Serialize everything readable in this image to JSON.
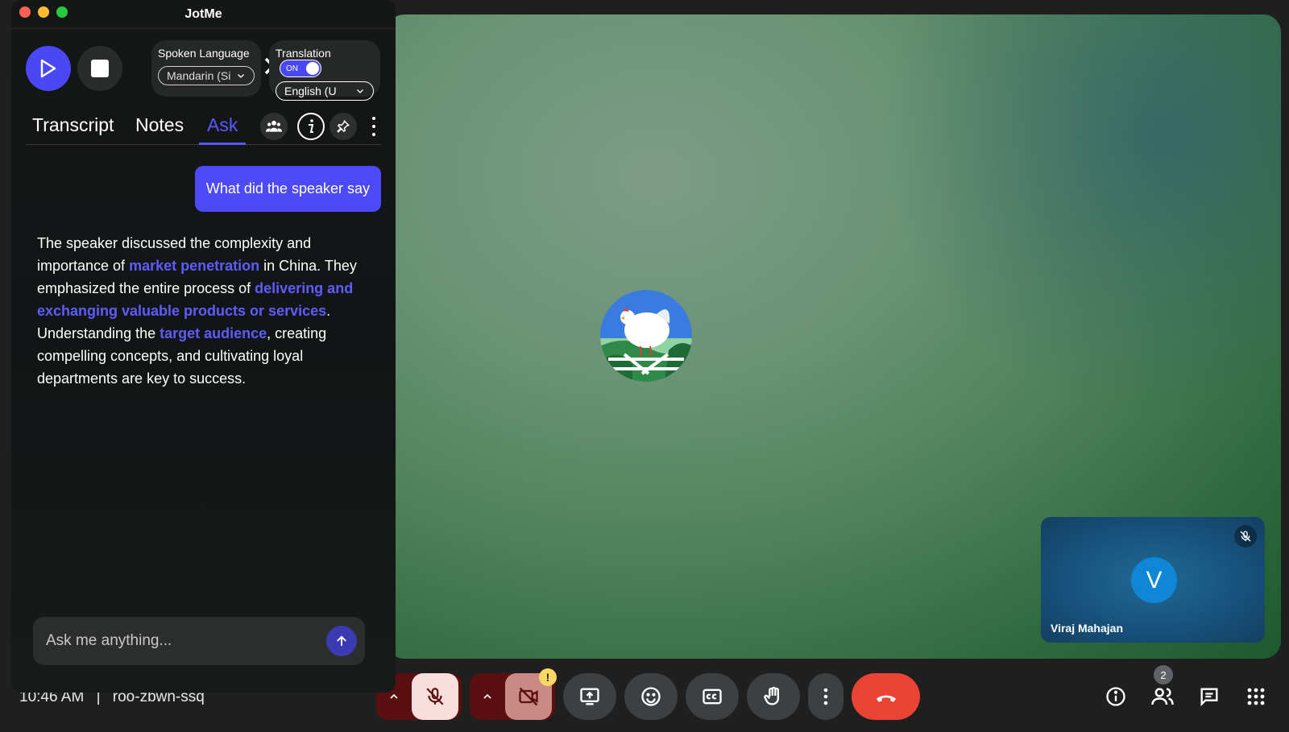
{
  "panel": {
    "app_title": "JotMe",
    "spoken_language": {
      "label": "Spoken Language",
      "value": "Mandarin (Si"
    },
    "translation": {
      "label": "Translation",
      "toggle_label": "ON",
      "value": "English (U"
    },
    "tabs": [
      {
        "label": "Transcript"
      },
      {
        "label": "Notes"
      },
      {
        "label": "Ask"
      }
    ],
    "question": "What did the speaker say",
    "answer": {
      "p1": "The speaker discussed the complexity and importance of ",
      "h1": "market penetration",
      "p2": " in China. They emphasized the entire process of ",
      "h2": "delivering and exchanging valuable products or services",
      "p3": ". Understanding the ",
      "h3": "target audience",
      "p4": ", creating compelling concepts, and cultivating loyal departments are key to success."
    },
    "ask_placeholder": "Ask me anything..."
  },
  "meeting": {
    "time": "10:46 AM",
    "separator": "|",
    "code": "roo-zbwn-ssq",
    "self_initial": "V",
    "self_name": "Viraj Mahajan",
    "participant_count": "2",
    "camera_warning": "!"
  },
  "colors": {
    "accent": "#4a47f5",
    "end_call": "#ea4335",
    "mic_off_bg": "#f9dedc",
    "cam_off_bg": "#c98a86"
  },
  "icons": {
    "controls": [
      "chevron-up-icon",
      "mic-off-icon",
      "chevron-up-icon",
      "camera-off-icon",
      "present-screen-icon",
      "emoji-icon",
      "captions-icon",
      "raise-hand-icon",
      "more-vert-icon",
      "end-call-icon"
    ],
    "right_tools": [
      "info-icon",
      "people-icon",
      "chat-icon",
      "apps-grid-icon"
    ]
  }
}
